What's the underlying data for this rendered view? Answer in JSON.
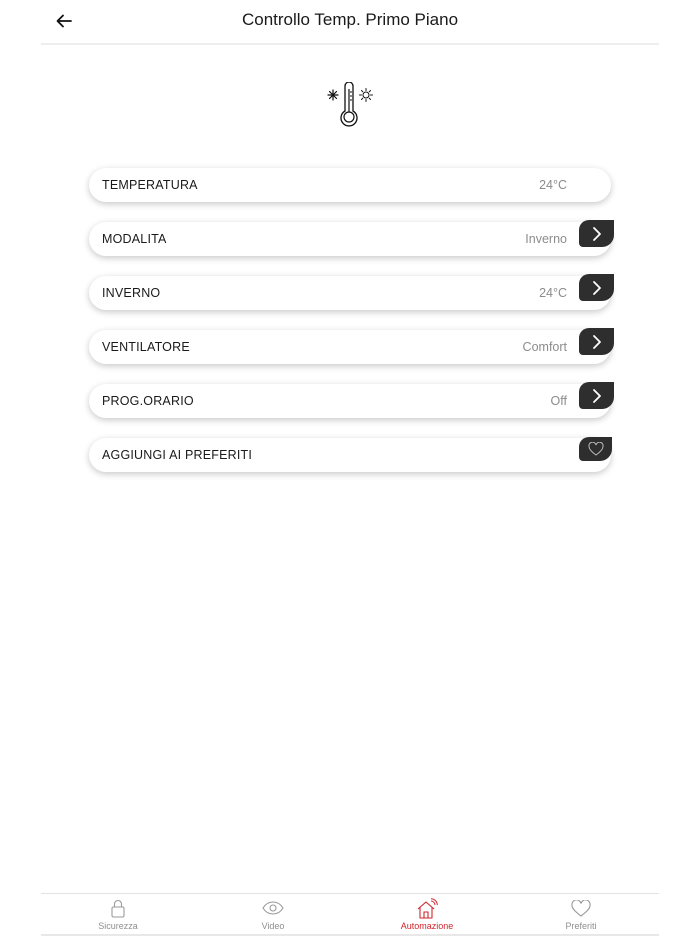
{
  "header": {
    "title": "Controllo Temp. Primo Piano",
    "back_icon": "arrow-left-icon"
  },
  "device": {
    "icon": "thermometer-snow-sun-icon"
  },
  "rows": [
    {
      "label": "TEMPERATURA",
      "value": "24°C",
      "action": null
    },
    {
      "label": "MODALITA",
      "value": "Inverno",
      "action": "chevron-right-icon"
    },
    {
      "label": "INVERNO",
      "value": "24°C",
      "action": "chevron-right-icon"
    },
    {
      "label": "VENTILATORE",
      "value": "Comfort",
      "action": "chevron-right-icon"
    },
    {
      "label": "PROG.ORARIO",
      "value": "Off",
      "action": "chevron-right-icon"
    },
    {
      "label": "AGGIUNGI AI PREFERITI",
      "value": "",
      "action": "heart-icon"
    }
  ],
  "bottom_nav": {
    "items": [
      {
        "label": "Sicurezza",
        "icon": "lock-icon",
        "active": false
      },
      {
        "label": "Video",
        "icon": "eye-icon",
        "active": false
      },
      {
        "label": "Automazione",
        "icon": "smart-home-icon",
        "active": true
      },
      {
        "label": "Preferiti",
        "icon": "heart-icon",
        "active": false
      }
    ]
  },
  "colors": {
    "accent_active": "#d0262e",
    "action_tab": "#2e2e2e",
    "value_text": "#8c8c8c"
  }
}
